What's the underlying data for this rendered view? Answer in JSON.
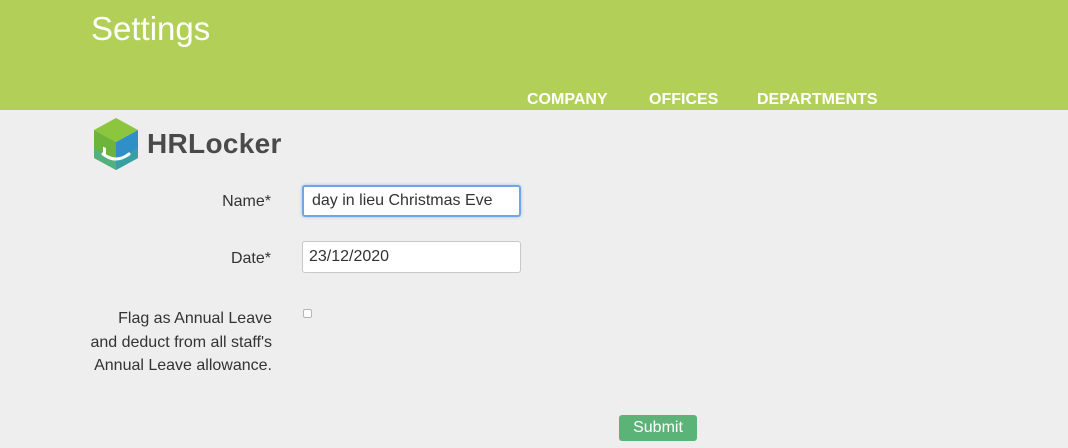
{
  "header": {
    "title": "Settings",
    "nav": [
      {
        "label": "COMPANY"
      },
      {
        "label": "OFFICES"
      },
      {
        "label": "DEPARTMENTS"
      }
    ],
    "background_color": "#b2d057"
  },
  "logo": {
    "text": "HRLocker",
    "icon": "hrlocker-cube-smile-icon",
    "colors": [
      "#6db43a",
      "#2f8fc6",
      "#4fb08a"
    ]
  },
  "form": {
    "name": {
      "label": "Name*",
      "value": "day in lieu Christmas Eve"
    },
    "date": {
      "label": "Date*",
      "value": "23/12/2020"
    },
    "annual_leave_flag": {
      "label": "Flag as Annual Leave and deduct from all staff's Annual Leave allowance.",
      "checked": false
    },
    "submit_label": "Submit",
    "submit_color": "#5cb377"
  }
}
